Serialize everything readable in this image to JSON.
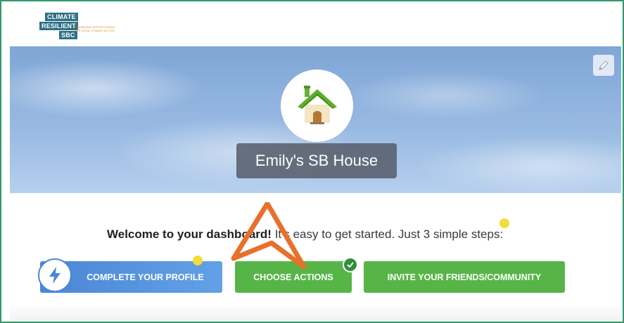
{
  "logo": {
    "line1": "CLIMATE",
    "line2": "RESILIENT",
    "line3": "SBC",
    "tagline": "Enhancing Opportunities for Local Climate Action"
  },
  "hero": {
    "house_name": "Emily's SB House",
    "edit_icon": "pencil-icon",
    "house_icon": "house-icon"
  },
  "welcome": {
    "bold": "Welcome to your dashboard!",
    "rest": "It's easy to get started. Just 3 simple steps:"
  },
  "steps": {
    "profile_label": "COMPLETE YOUR PROFILE",
    "actions_label": "CHOOSE ACTIONS",
    "invite_label": "INVITE YOUR FRIENDS/COMMUNITY",
    "profile_icon": "lightning-bolt-icon",
    "actions_status_icon": "checkmark-icon"
  },
  "colors": {
    "frame": "#2f9a6a",
    "blue": "#4b86d6",
    "green": "#57b548",
    "annotation": "#e8702a",
    "highlight": "#f3dd3a"
  }
}
